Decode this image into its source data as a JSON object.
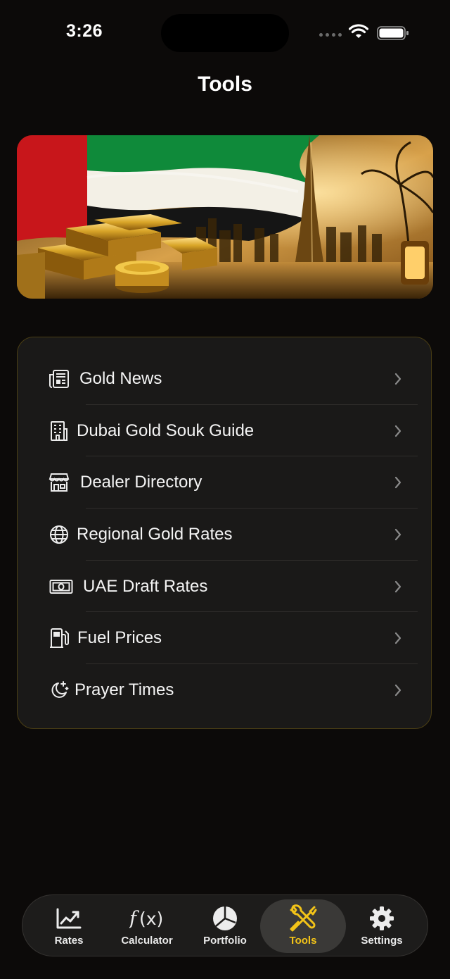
{
  "status_bar": {
    "time": "3:26"
  },
  "header": {
    "title": "Tools"
  },
  "hero": {
    "image": "uae-flag-gold-bars-dubai-skyline"
  },
  "menu": {
    "items": [
      {
        "label": "Gold News",
        "icon": "newspaper-icon"
      },
      {
        "label": "Dubai Gold Souk Guide",
        "icon": "building-icon"
      },
      {
        "label": "Dealer Directory",
        "icon": "storefront-icon"
      },
      {
        "label": "Regional Gold Rates",
        "icon": "globe-icon"
      },
      {
        "label": "UAE Draft Rates",
        "icon": "banknote-icon"
      },
      {
        "label": "Fuel Prices",
        "icon": "fuel-pump-icon"
      },
      {
        "label": "Prayer Times",
        "icon": "moon-stars-icon"
      }
    ]
  },
  "tab_bar": {
    "active": "Tools",
    "accent_color": "#f2c318",
    "tabs": [
      {
        "label": "Rates",
        "icon": "chart-line-icon"
      },
      {
        "label": "Calculator",
        "icon": "function-icon"
      },
      {
        "label": "Portfolio",
        "icon": "pie-chart-icon"
      },
      {
        "label": "Tools",
        "icon": "wrench-screwdriver-icon"
      },
      {
        "label": "Settings",
        "icon": "gear-icon"
      }
    ]
  }
}
